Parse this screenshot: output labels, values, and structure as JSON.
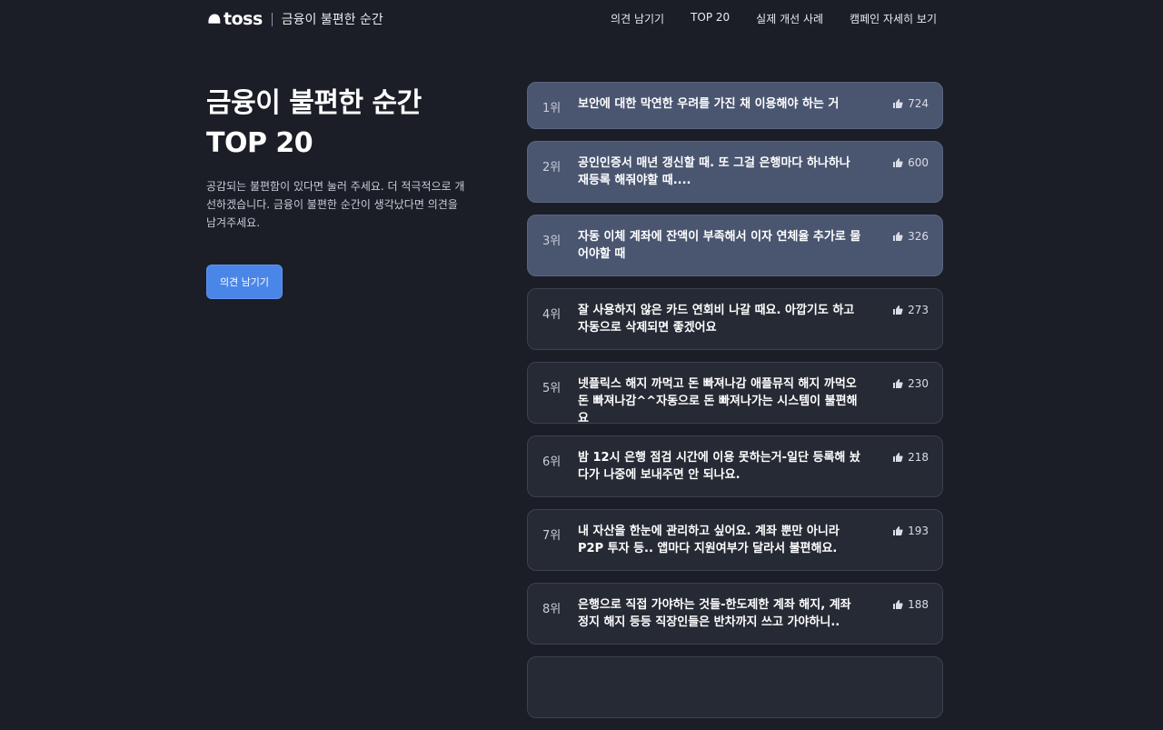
{
  "nav": {
    "brand": "toss",
    "subtitle": "금융이 불편한 순간",
    "links": [
      "의견 남기기",
      "TOP 20",
      "실제 개선 사례",
      "캠페인 자세히 보기"
    ]
  },
  "hero": {
    "title_line1": "금융이 불편한 순간",
    "title_line2": "TOP 20",
    "description": "공감되는 불편함이 있다면 눌러 주세요. 더 적극적으로 개선하겠습니다. 금융이 불편한 순간이 생각났다면 의견을 남겨주세요.",
    "cta": "의견 남기기"
  },
  "ranking": [
    {
      "rank": "1위",
      "text": "보안에 대한 막연한 우려를 가진 채 이용해야 하는 거",
      "likes": "724"
    },
    {
      "rank": "2위",
      "text": "공인인증서 매년 갱신할 때. 또 그걸 은행마다 하나하나 재등록 해줘야할 때....",
      "likes": "600"
    },
    {
      "rank": "3위",
      "text": "자동 이체 계좌에 잔액이 부족해서 이자 연체율 추가로 물어야할 때",
      "likes": "326"
    },
    {
      "rank": "4위",
      "text": "잘 사용하지 않은 카드 연회비 나갈 때요. 아깝기도 하고 자동으로 삭제되면 좋겠어요",
      "likes": "273"
    },
    {
      "rank": "5위",
      "text": "넷플릭스 해지 까먹고 돈 빠져나감 애플뮤직 해지 까먹오 돈 빠져나감^^자동으로 돈 빠져나가는 시스템이 불편해요",
      "likes": "230"
    },
    {
      "rank": "6위",
      "text": "밤 12시 은행 점검 시간에 이용 못하는거-일단 등록해 놨다가 나중에 보내주면 안 되나요.",
      "likes": "218"
    },
    {
      "rank": "7위",
      "text": "내 자산을 한눈에 관리하고 싶어요. 계좌 뿐만 아니라 P2P 투자 등.. 앱마다 지원여부가 달라서 불편해요.",
      "likes": "193"
    },
    {
      "rank": "8위",
      "text": "은행으로 직접 가야하는 것들-한도제한 계좌 해지, 계좌 정지 해지 등등 직장인들은 반차까지 쓰고 가야하니..",
      "likes": "188"
    }
  ],
  "colors": {
    "background": "#1b1e26",
    "card": "#262a34",
    "card_highlight": "#4a5570",
    "accent": "#4a86e8"
  },
  "icons": {
    "logo": "toss-logo-icon",
    "like": "thumbs-up-icon"
  }
}
